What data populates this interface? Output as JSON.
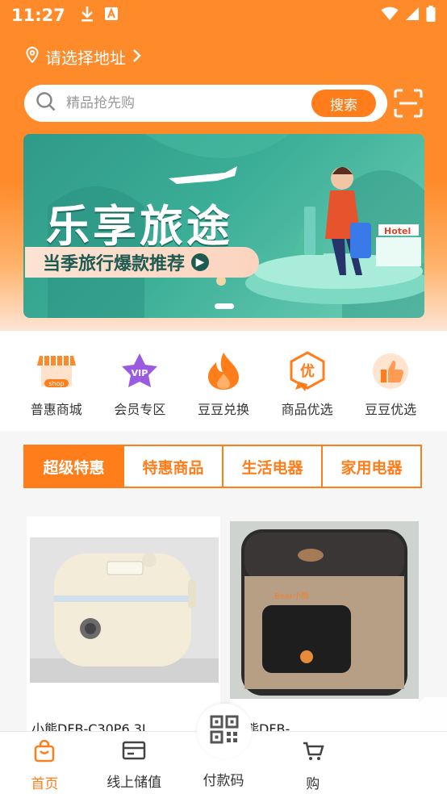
{
  "status_bar": {
    "time": "11:27"
  },
  "header": {
    "location_label": "请选择地址"
  },
  "search": {
    "placeholder": "精品抢先购",
    "button_label": "搜索"
  },
  "banner": {
    "title": "乐享旅途",
    "subtitle": "当季旅行爆款推荐",
    "sign_text": "Hotel"
  },
  "quick_nav": [
    {
      "label": "普惠商城",
      "icon": "shop-icon",
      "icon_text": "shop"
    },
    {
      "label": "会员专区",
      "icon": "vip-star-icon",
      "icon_text": "VIP"
    },
    {
      "label": "豆豆兑换",
      "icon": "flame-icon"
    },
    {
      "label": "商品优选",
      "icon": "quality-badge-icon",
      "icon_text": "优"
    },
    {
      "label": "豆豆优选",
      "icon": "thumbs-up-icon"
    }
  ],
  "tabs": [
    {
      "label": "超级特惠",
      "active": true
    },
    {
      "label": "特惠商品",
      "active": false
    },
    {
      "label": "生活电器",
      "active": false
    },
    {
      "label": "家用电器",
      "active": false
    }
  ],
  "products": [
    {
      "name": "小熊DFB-C30P6 3L",
      "brand_mark": ""
    },
    {
      "name": "熊DFB-",
      "brand_mark": "Bear小熊"
    }
  ],
  "bottom_nav": [
    {
      "label": "首页",
      "icon": "bag-icon",
      "active": true
    },
    {
      "label": "线上储值",
      "icon": "card-icon",
      "active": false
    },
    {
      "label": "付款码",
      "icon": "qrcode-icon",
      "active": false
    },
    {
      "label": "购",
      "icon": "cart-icon",
      "active": false
    }
  ],
  "colors": {
    "accent": "#ff7d1a",
    "banner_green": "#3bae97"
  }
}
